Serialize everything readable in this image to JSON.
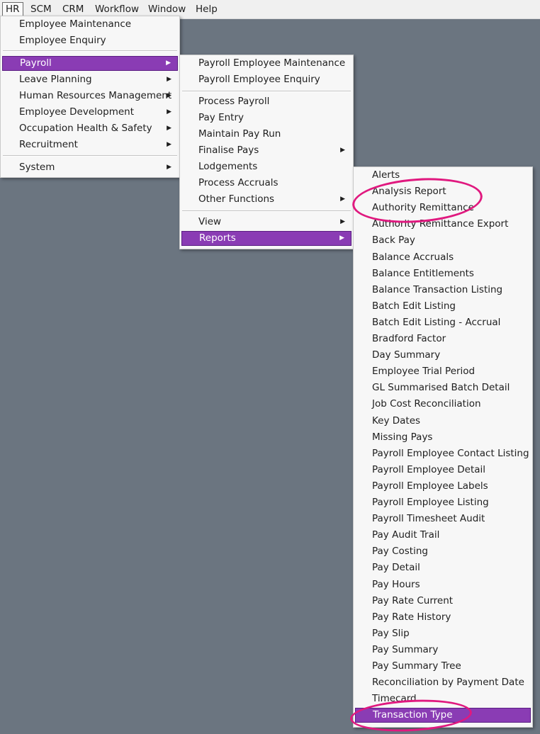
{
  "menubar": {
    "items": [
      "HR",
      "SCM",
      "CRM",
      "Workflow",
      "Window",
      "Help"
    ]
  },
  "hr_menu": {
    "group1": [
      "Employee Maintenance",
      "Employee Enquiry"
    ],
    "group2": [
      "Payroll",
      "Leave Planning",
      "Human Resources Management",
      "Employee Development",
      "Occupation Health & Safety",
      "Recruitment"
    ],
    "group3": [
      "System"
    ]
  },
  "payroll_menu": {
    "group1": [
      "Payroll Employee Maintenance",
      "Payroll Employee Enquiry"
    ],
    "group2": [
      "Process Payroll",
      "Pay Entry",
      "Maintain Pay Run",
      "Finalise Pays",
      "Lodgements",
      "Process Accruals",
      "Other Functions"
    ],
    "group3": [
      "View",
      "Reports"
    ]
  },
  "reports_menu": {
    "items": [
      "Alerts",
      "Analysis Report",
      "Authority Remittance",
      "Authority Remittance Export",
      "Back Pay",
      "Balance Accruals",
      "Balance Entitlements",
      "Balance Transaction Listing",
      "Batch Edit Listing",
      "Batch Edit Listing - Accrual",
      "Bradford Factor",
      "Day Summary",
      "Employee Trial Period",
      "GL Summarised Batch Detail",
      "Job Cost Reconciliation",
      "Key Dates",
      "Missing Pays",
      "Payroll Employee Contact Listing",
      "Payroll Employee Detail",
      "Payroll Employee Labels",
      "Payroll Employee Listing",
      "Payroll Timesheet Audit",
      "Pay Audit Trail",
      "Pay Costing",
      "Pay Detail",
      "Pay Hours",
      "Pay Rate Current",
      "Pay Rate History",
      "Pay Slip",
      "Pay Summary",
      "Pay Summary Tree",
      "Reconciliation by Payment Date",
      "Timecard",
      "Transaction Type"
    ]
  },
  "colors": {
    "highlight": "#8a3cb4",
    "annotation": "#e0197f",
    "desktop": "#6b7580"
  },
  "icons": {
    "submenu": "submenu-arrow-icon"
  }
}
